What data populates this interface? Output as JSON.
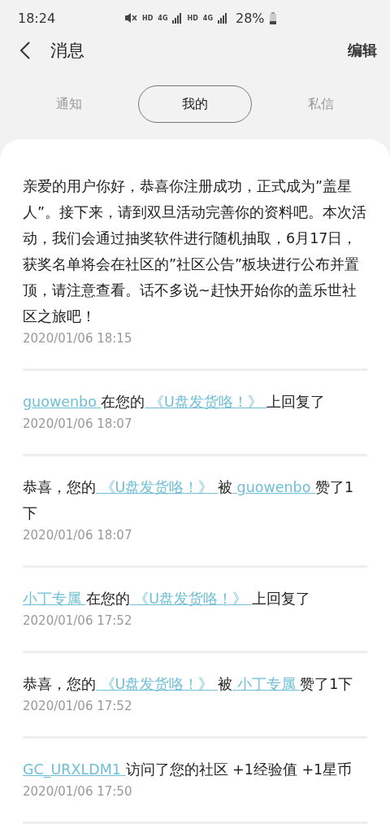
{
  "status_bar": {
    "time": "18:24",
    "hd_1": "HD",
    "network_1": "4G",
    "hd_2": "HD",
    "network_2": "4G",
    "battery": "28%"
  },
  "header": {
    "title": "消息",
    "action": "编辑"
  },
  "tabs": [
    {
      "label": "通知",
      "selected": false
    },
    {
      "label": "我的",
      "selected": true
    },
    {
      "label": "私信",
      "selected": false
    }
  ],
  "messages": [
    {
      "parts": [
        {
          "kind": "text",
          "text": "亲爱的用户你好，恭喜你注册成功，正式成为”盖星人”。接下来，请到双旦活动完善你的资料吧。本次活动，我们会通过抽奖软件进行随机抽取，6月17日，获奖名单将会在社区的”社区公告”板块进行公布并置顶，请注意查看。话不多说~赶快开始你的盖乐世社区之旅吧！"
        }
      ],
      "time": "2020/01/06 18:15"
    },
    {
      "parts": [
        {
          "kind": "link",
          "text": "guowenbo"
        },
        {
          "kind": "text",
          "text": "在您的"
        },
        {
          "kind": "link",
          "text": "《U盘发货咯！》"
        },
        {
          "kind": "text",
          "text": "上回复了"
        }
      ],
      "time": "2020/01/06 18:07"
    },
    {
      "parts": [
        {
          "kind": "text",
          "text": "恭喜，您的"
        },
        {
          "kind": "link",
          "text": "《U盘发货咯！》"
        },
        {
          "kind": "text",
          "text": "被"
        },
        {
          "kind": "link",
          "text": "guowenbo"
        },
        {
          "kind": "text",
          "text": "赞了1下"
        }
      ],
      "time": "2020/01/06 18:07"
    },
    {
      "parts": [
        {
          "kind": "link",
          "text": "小丁专属"
        },
        {
          "kind": "text",
          "text": "在您的"
        },
        {
          "kind": "link",
          "text": "《U盘发货咯！》"
        },
        {
          "kind": "text",
          "text": "上回复了"
        }
      ],
      "time": "2020/01/06 17:52"
    },
    {
      "parts": [
        {
          "kind": "text",
          "text": "恭喜，您的"
        },
        {
          "kind": "link",
          "text": "《U盘发货咯！》"
        },
        {
          "kind": "text",
          "text": "被"
        },
        {
          "kind": "link",
          "text": "小丁专属"
        },
        {
          "kind": "text",
          "text": "赞了1下"
        }
      ],
      "time": "2020/01/06 17:52"
    },
    {
      "parts": [
        {
          "kind": "link",
          "text": "GC_URXLDM1"
        },
        {
          "kind": "text",
          "text": "访问了您的社区 +1经验值 +1星币"
        }
      ],
      "time": "2020/01/06 17:50"
    }
  ]
}
